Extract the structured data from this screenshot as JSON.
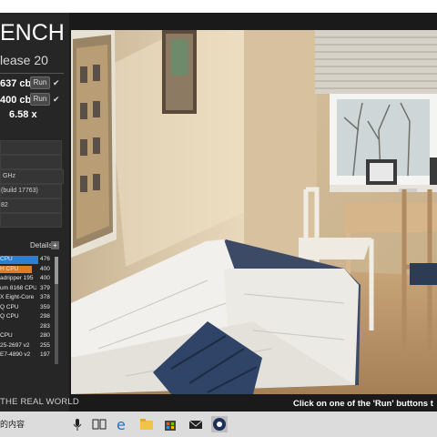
{
  "app": {
    "logo_text": "ENCH",
    "release": "lease 20",
    "tagline": "THE REAL WORLD",
    "hint": "Click on one of the 'Run' buttons t"
  },
  "scores": [
    {
      "value": "637 cb",
      "run_label": "Run",
      "check": "✔"
    },
    {
      "value": "400 cb",
      "run_label": "Run",
      "check": "✔"
    }
  ],
  "ratio": "6.58 x",
  "system": {
    "ghz": "GHz",
    "build": "(build 17763)",
    "code": "82"
  },
  "ranking": {
    "details_label": "Details",
    "plus": "+",
    "rows": [
      {
        "name": "CPU",
        "value": "476",
        "color": "#2e7fcf"
      },
      {
        "name": "H CPU",
        "value": "400",
        "color": "#e07b22"
      },
      {
        "name": "adripper 195",
        "value": "400",
        "color": ""
      },
      {
        "name": "um 8168 CPU",
        "value": "379",
        "color": ""
      },
      {
        "name": "X Eight-Core",
        "value": "378",
        "color": ""
      },
      {
        "name": "Q CPU",
        "value": "359",
        "color": ""
      },
      {
        "name": "Q CPU",
        "value": "298",
        "color": ""
      },
      {
        "name": "",
        "value": "283",
        "color": ""
      },
      {
        "name": "CPU",
        "value": "280",
        "color": ""
      },
      {
        "name": "25-2697 v2",
        "value": "255",
        "color": ""
      },
      {
        "name": "E7-4890 v2",
        "value": "197",
        "color": ""
      }
    ]
  },
  "taskbar": {
    "search_text": "的内容",
    "icons": [
      "mic-icon",
      "task-view-icon",
      "edge-icon",
      "file-explorer-icon",
      "store-icon",
      "mail-icon",
      "cinebench-icon"
    ]
  }
}
